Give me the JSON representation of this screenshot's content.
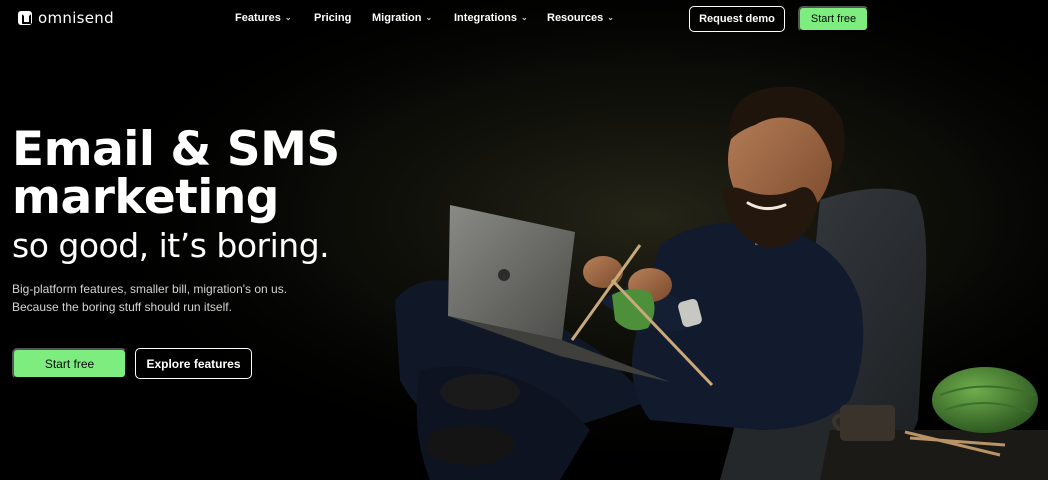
{
  "brand": {
    "name": "omnisend",
    "logo_icon": "omnisend-logo-icon"
  },
  "nav": {
    "items": [
      {
        "label": "Features",
        "has_dropdown": true
      },
      {
        "label": "Pricing",
        "has_dropdown": false
      },
      {
        "label": "Migration",
        "has_dropdown": true
      },
      {
        "label": "Integrations",
        "has_dropdown": true
      },
      {
        "label": "Resources",
        "has_dropdown": true
      }
    ],
    "chevron_icon": "chevron-down-icon",
    "request_demo_label": "Request demo",
    "start_free_label": "Start free"
  },
  "hero": {
    "headline_line1": "Email & SMS",
    "headline_line2": "marketing",
    "subheadline": "so good, it’s boring.",
    "description_line1": "Big-platform features, smaller bill, migration's on us.",
    "description_line2": "Because the boring stuff should run itself.",
    "start_free_label": "Start free",
    "explore_label": "Explore features"
  },
  "colors": {
    "accent_green": "#7ded7f",
    "background": "#000000",
    "text": "#ffffff"
  }
}
